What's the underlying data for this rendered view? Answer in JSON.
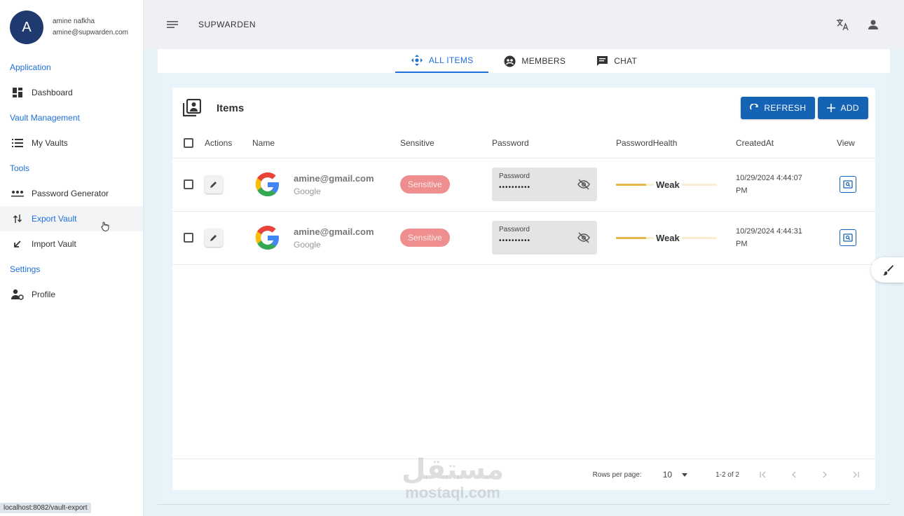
{
  "user": {
    "avatar_letter": "A",
    "name": "amine nafkha",
    "email": "amine@supwarden.com"
  },
  "sidebar": {
    "sections": [
      {
        "title": "Application",
        "items": [
          {
            "label": "Dashboard",
            "icon": "dashboard-icon"
          }
        ]
      },
      {
        "title": "Vault Management",
        "items": [
          {
            "label": "My Vaults",
            "icon": "list-icon"
          }
        ]
      },
      {
        "title": "Tools",
        "items": [
          {
            "label": "Password Generator",
            "icon": "password-icon"
          },
          {
            "label": "Export Vault",
            "icon": "export-icon",
            "active": true
          },
          {
            "label": "Import Vault",
            "icon": "import-icon"
          }
        ]
      },
      {
        "title": "Settings",
        "items": [
          {
            "label": "Profile",
            "icon": "profile-icon"
          }
        ]
      }
    ]
  },
  "topbar": {
    "title": "SUPWARDEN",
    "icons": [
      "dark-mode-icon",
      "translate-icon",
      "account-icon"
    ]
  },
  "tabs": [
    {
      "label": "ALL ITEMS",
      "icon": "all-items-icon",
      "active": true
    },
    {
      "label": "MEMBERS",
      "icon": "members-icon"
    },
    {
      "label": "CHAT",
      "icon": "chat-icon"
    }
  ],
  "card": {
    "title": "Items",
    "refresh_label": "REFRESH",
    "add_label": "ADD",
    "columns": [
      "Actions",
      "Name",
      "Sensitive",
      "Password",
      "PasswordHealth",
      "CreatedAt",
      "View"
    ],
    "rows": [
      {
        "name": "amine@gmail.com",
        "site": "Google",
        "sensitive": "Sensitive",
        "password_label": "Password",
        "password_mask": "••••••••••",
        "health": "Weak",
        "health_level": 0.3,
        "created_line1": "10/29/2024 4:44:07",
        "created_line2": "PM"
      },
      {
        "name": "amine@gmail.com",
        "site": "Google",
        "sensitive": "Sensitive",
        "password_label": "Password",
        "password_mask": "••••••••••",
        "health": "Weak",
        "health_level": 0.3,
        "created_line1": "10/29/2024 4:44:31",
        "created_line2": "PM"
      }
    ],
    "footer": {
      "rows_per_page_label": "Rows per page:",
      "rows_per_page_value": "10",
      "range": "1-2 of 2"
    }
  },
  "status_url": "localhost:8082/vault-export",
  "watermark": {
    "arabic": "مستقل",
    "latin": "mostaql.com"
  },
  "colors": {
    "primary": "#1563b5",
    "link": "#1e6fd9",
    "sensitive_badge": "#ee8e8e",
    "health_weak": "#e6b84a"
  }
}
